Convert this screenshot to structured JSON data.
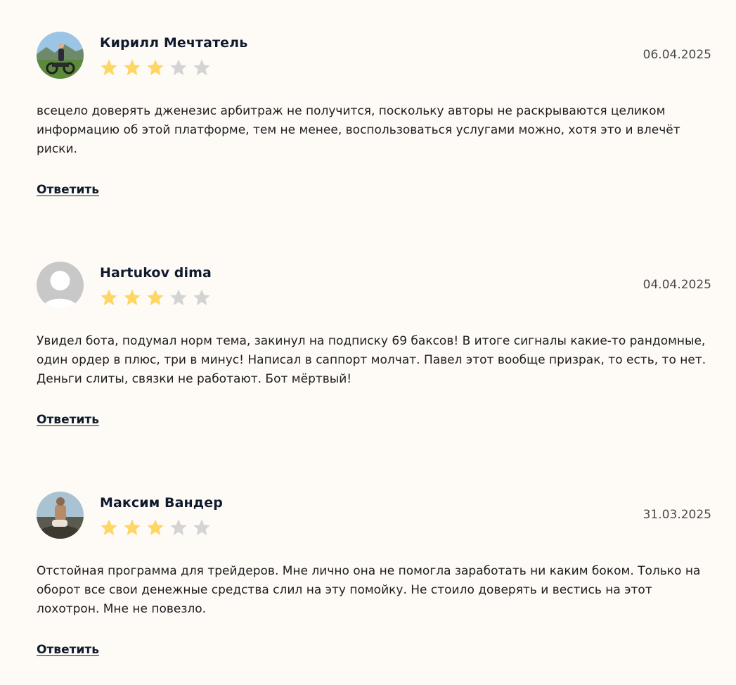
{
  "reviews": [
    {
      "author": "Кирилл Мечтатель",
      "date": "06.04.2025",
      "rating": 3,
      "max_rating": 5,
      "text": "всецело доверять дженезис арбитраж не получится, поскольку авторы не раскрываются целиком информацию об этой платформе, тем не менее, воспользоваться услугами можно, хотя это и влечёт риски.",
      "reply_label": "Ответить"
    },
    {
      "author": "Hartukov dima",
      "date": "04.04.2025",
      "rating": 3,
      "max_rating": 5,
      "text": "Увидел бота, подумал норм тема, закинул на подписку 69 баксов! В итоге сигналы какие-то рандомные, один ордер в плюс, три в минус! Написал в саппорт молчат. Павел этот вообще призрак, то есть, то нет. Деньги слиты, связки не работают. Бот мёртвый!",
      "reply_label": "Ответить"
    },
    {
      "author": "Максим Вандер",
      "date": "31.03.2025",
      "rating": 3,
      "max_rating": 5,
      "text": "Отстойная программа для трейдеров. Мне лично она не помогла заработать ни каким боком. Только на оборот все свои денежные средства слил на эту помойку. Не стоило доверять и вестись на этот лохотрон. Мне не повезло.",
      "reply_label": "Ответить"
    }
  ],
  "colors": {
    "star_filled": "#fdd663",
    "star_empty": "#d4d4d4",
    "background": "#fefbf7",
    "author": "#0f1b2d"
  }
}
